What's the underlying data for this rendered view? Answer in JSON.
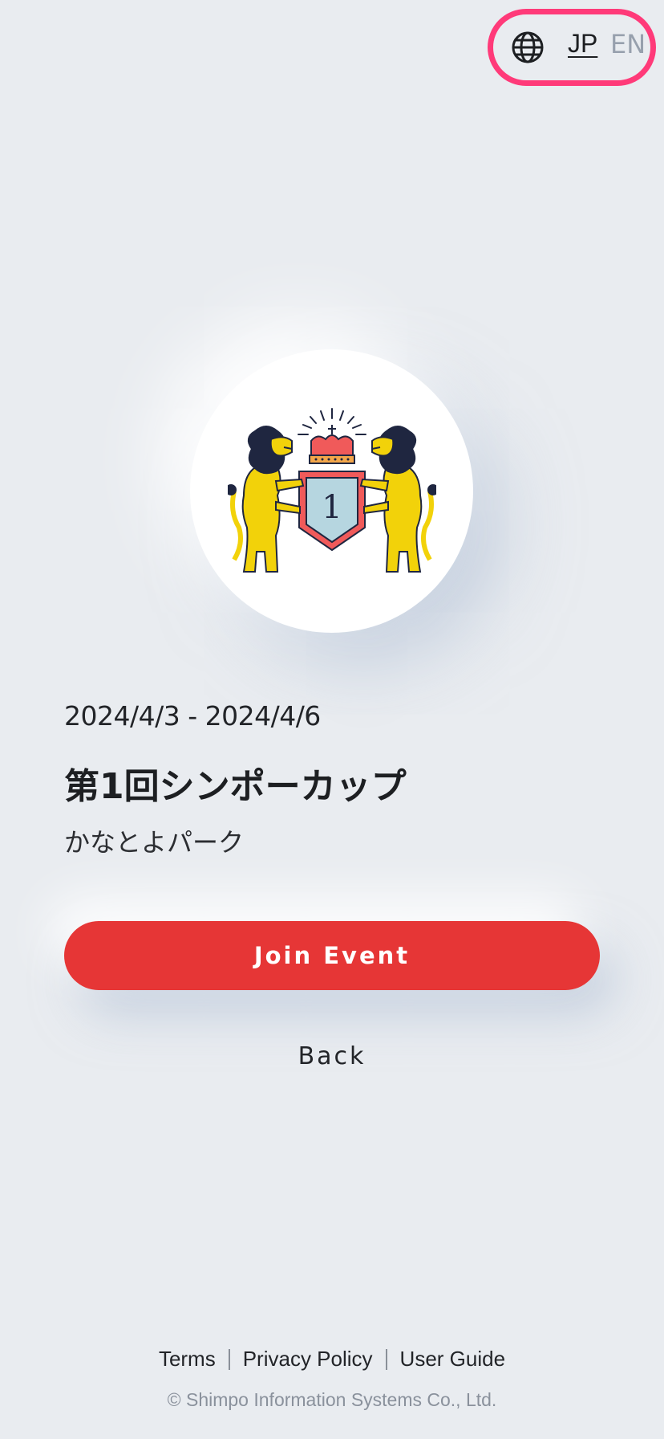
{
  "language": {
    "icon": "globe-icon",
    "options": [
      "JP",
      "EN"
    ],
    "active": "JP",
    "highlight_color": "#ff3a79"
  },
  "event": {
    "logo": "lion-crest-logo",
    "logo_number": "1",
    "date_range": "2024/4/3 - 2024/4/6",
    "title": "第1回シンポーカップ",
    "venue": "かなとよパーク"
  },
  "actions": {
    "join_label": "Join Event",
    "back_label": "Back",
    "accent_color": "#e63636"
  },
  "footer": {
    "links": [
      "Terms",
      "Privacy Policy",
      "User Guide"
    ],
    "copyright": "© Shimpo Information Systems Co., Ltd."
  }
}
